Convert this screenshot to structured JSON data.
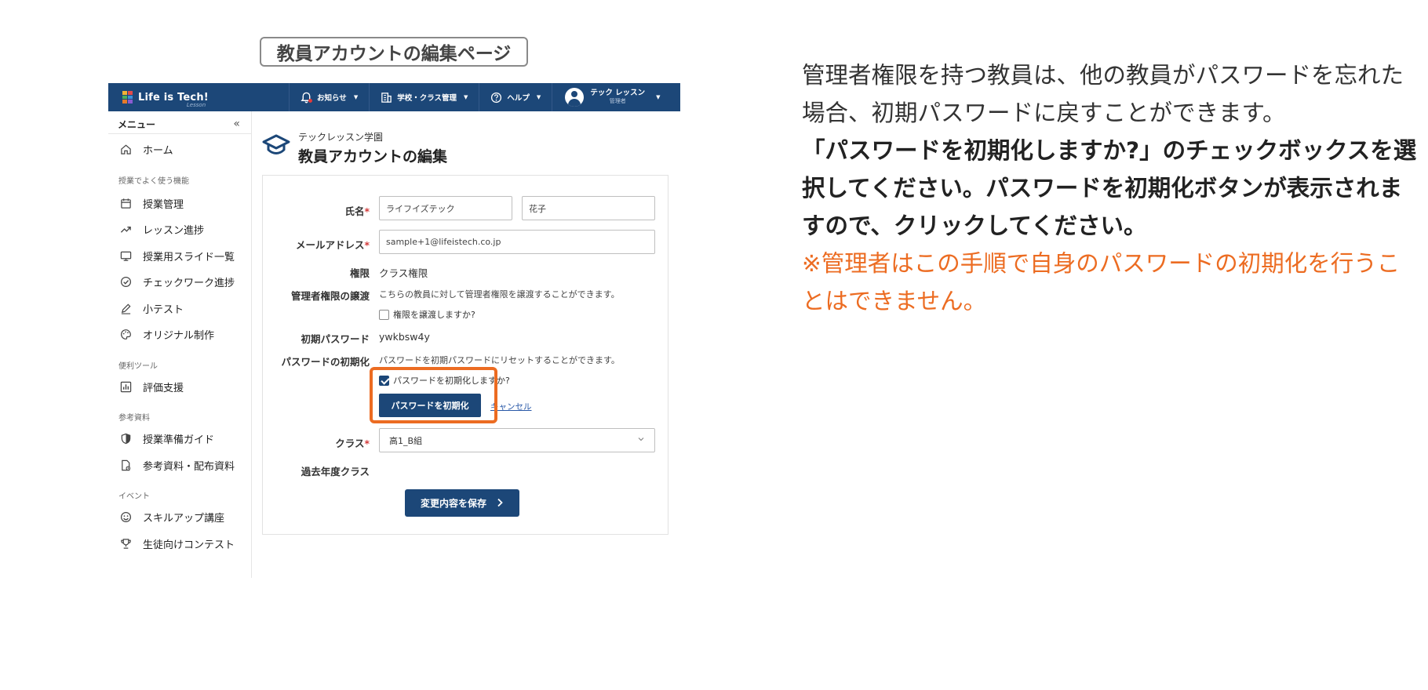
{
  "page_label": "教員アカウントの編集ページ",
  "topbar": {
    "logo_text": "Life is Tech!",
    "logo_sub": "Lesson",
    "nav": [
      {
        "label": "お知らせ"
      },
      {
        "label": "学校・クラス管理"
      },
      {
        "label": "ヘルプ"
      }
    ],
    "user_name": "テック レッスン",
    "user_role": "管理者"
  },
  "sidebar": {
    "title": "メニュー",
    "collapse": "«",
    "home": "ホーム",
    "sections": [
      {
        "label": "授業でよく使う機能",
        "items": [
          "授業管理",
          "レッスン進捗",
          "授業用スライド一覧",
          "チェックワーク進捗",
          "小テスト",
          "オリジナル制作"
        ]
      },
      {
        "label": "便利ツール",
        "items": [
          "評価支援"
        ]
      },
      {
        "label": "参考資料",
        "items": [
          "授業準備ガイド",
          "参考資料・配布資料"
        ]
      },
      {
        "label": "イベント",
        "items": [
          "スキルアップ講座",
          "生徒向けコンテスト"
        ]
      }
    ]
  },
  "main": {
    "school_name": "テックレッスン学園",
    "title": "教員アカウントの編集",
    "form": {
      "name_label": "氏名",
      "last_name": "ライフイズテック",
      "first_name": "花子",
      "email_label": "メールアドレス",
      "email": "sample+1@lifeistech.co.jp",
      "role_label": "権限",
      "role_value": "クラス権限",
      "transfer_label": "管理者権限の譲渡",
      "transfer_note": "こちらの教員に対して管理者権限を譲渡することができます。",
      "transfer_check": "権限を譲渡しますか?",
      "initial_pw_label": "初期パスワード",
      "initial_pw": "ywkbsw4y",
      "reset_label": "パスワードの初期化",
      "reset_note": "パスワードを初期パスワードにリセットすることができます。",
      "reset_check": "パスワードを初期化しますか?",
      "reset_button": "パスワードを初期化",
      "cancel": "キャンセル",
      "class_label": "クラス",
      "class_value": "高1_B組",
      "past_class_label": "過去年度クラス",
      "save_button": "変更内容を保存",
      "required_mark": "*"
    }
  },
  "description": {
    "line1": "管理者権限を持つ教員は、他の教員がパスワードを忘れた場合、初期パスワードに戻すことができます。",
    "line2": "「パスワードを初期化しますか?」のチェックボックスを選択してください。パスワードを初期化ボタンが表示されますので、クリックしてください。",
    "line3": "※管理者はこの手順で自身のパスワードの初期化を行うことはできません。"
  },
  "colors": {
    "brand": "#1c4778",
    "highlight": "#ec6c22",
    "required": "#d23a3a",
    "note_text": "#ec6c22"
  }
}
